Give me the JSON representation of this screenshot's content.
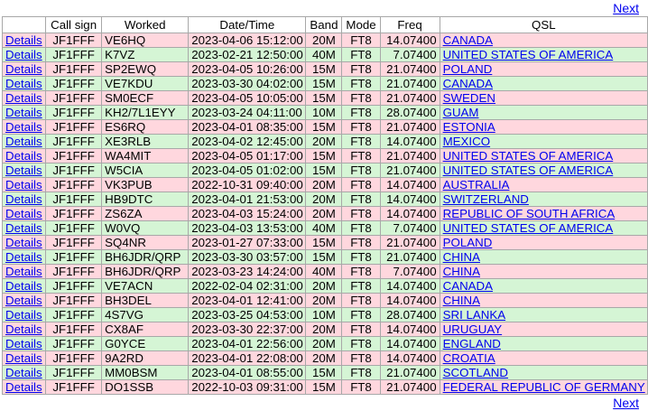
{
  "nav": {
    "next_label": "Next"
  },
  "table": {
    "headers": [
      "",
      "Call sign",
      "Worked",
      "Date/Time",
      "Band",
      "Mode",
      "Freq",
      "QSL"
    ],
    "details_label": "Details",
    "rows": [
      [
        "JF1FFF",
        "VE6HQ",
        "2023-04-06 15:12:00",
        "20M",
        "FT8",
        "14.07400",
        "CANADA"
      ],
      [
        "JF1FFF",
        "K7VZ",
        "2023-02-21 12:50:00",
        "40M",
        "FT8",
        "7.07400",
        "UNITED STATES OF AMERICA"
      ],
      [
        "JF1FFF",
        "SP2EWQ",
        "2023-04-05 10:26:00",
        "15M",
        "FT8",
        "21.07400",
        "POLAND"
      ],
      [
        "JF1FFF",
        "VE7KDU",
        "2023-03-30 04:02:00",
        "15M",
        "FT8",
        "21.07400",
        "CANADA"
      ],
      [
        "JF1FFF",
        "SM0ECF",
        "2023-04-05 10:05:00",
        "15M",
        "FT8",
        "21.07400",
        "SWEDEN"
      ],
      [
        "JF1FFF",
        "KH2/7L1EYY",
        "2023-03-24 04:11:00",
        "10M",
        "FT8",
        "28.07400",
        "GUAM"
      ],
      [
        "JF1FFF",
        "ES6RQ",
        "2023-04-01 08:35:00",
        "15M",
        "FT8",
        "21.07400",
        "ESTONIA"
      ],
      [
        "JF1FFF",
        "XE3RLB",
        "2023-04-02 12:45:00",
        "20M",
        "FT8",
        "14.07400",
        "MEXICO"
      ],
      [
        "JF1FFF",
        "WA4MIT",
        "2023-04-05 01:17:00",
        "15M",
        "FT8",
        "21.07400",
        "UNITED STATES OF AMERICA"
      ],
      [
        "JF1FFF",
        "W5CIA",
        "2023-04-05 01:02:00",
        "15M",
        "FT8",
        "21.07400",
        "UNITED STATES OF AMERICA"
      ],
      [
        "JF1FFF",
        "VK3PUB",
        "2022-10-31 09:40:00",
        "20M",
        "FT8",
        "14.07400",
        "AUSTRALIA"
      ],
      [
        "JF1FFF",
        "HB9DTC",
        "2023-04-01 21:53:00",
        "20M",
        "FT8",
        "14.07400",
        "SWITZERLAND"
      ],
      [
        "JF1FFF",
        "ZS6ZA",
        "2023-04-03 15:24:00",
        "20M",
        "FT8",
        "14.07400",
        "REPUBLIC OF SOUTH AFRICA"
      ],
      [
        "JF1FFF",
        "W0VQ",
        "2023-04-03 13:53:00",
        "40M",
        "FT8",
        "7.07400",
        "UNITED STATES OF AMERICA"
      ],
      [
        "JF1FFF",
        "SQ4NR",
        "2023-01-27 07:33:00",
        "15M",
        "FT8",
        "21.07400",
        "POLAND"
      ],
      [
        "JF1FFF",
        "BH6JDR/QRP",
        "2023-03-30 03:57:00",
        "15M",
        "FT8",
        "21.07400",
        "CHINA"
      ],
      [
        "JF1FFF",
        "BH6JDR/QRP",
        "2023-03-23 14:24:00",
        "40M",
        "FT8",
        "7.07400",
        "CHINA"
      ],
      [
        "JF1FFF",
        "VE7ACN",
        "2022-02-04 02:31:00",
        "20M",
        "FT8",
        "14.07400",
        "CANADA"
      ],
      [
        "JF1FFF",
        "BH3DEL",
        "2023-04-01 12:41:00",
        "20M",
        "FT8",
        "14.07400",
        "CHINA"
      ],
      [
        "JF1FFF",
        "4S7VG",
        "2023-03-25 04:53:00",
        "10M",
        "FT8",
        "28.07400",
        "SRI LANKA"
      ],
      [
        "JF1FFF",
        "CX8AF",
        "2023-03-30 22:37:00",
        "20M",
        "FT8",
        "14.07400",
        "URUGUAY"
      ],
      [
        "JF1FFF",
        "G0YCE",
        "2023-04-01 22:56:00",
        "20M",
        "FT8",
        "14.07400",
        "ENGLAND"
      ],
      [
        "JF1FFF",
        "9A2RD",
        "2023-04-01 22:08:00",
        "20M",
        "FT8",
        "14.07400",
        "CROATIA"
      ],
      [
        "JF1FFF",
        "MM0BSM",
        "2023-04-01 08:55:00",
        "15M",
        "FT8",
        "21.07400",
        "SCOTLAND"
      ],
      [
        "JF1FFF",
        "DO1SSB",
        "2022-10-03 09:31:00",
        "15M",
        "FT8",
        "21.07400",
        "FEDERAL REPUBLIC OF GERMANY"
      ]
    ]
  },
  "colors": {
    "row_a": "#ffd7de",
    "row_b": "#d5f5d5",
    "link": "#0000ee"
  }
}
